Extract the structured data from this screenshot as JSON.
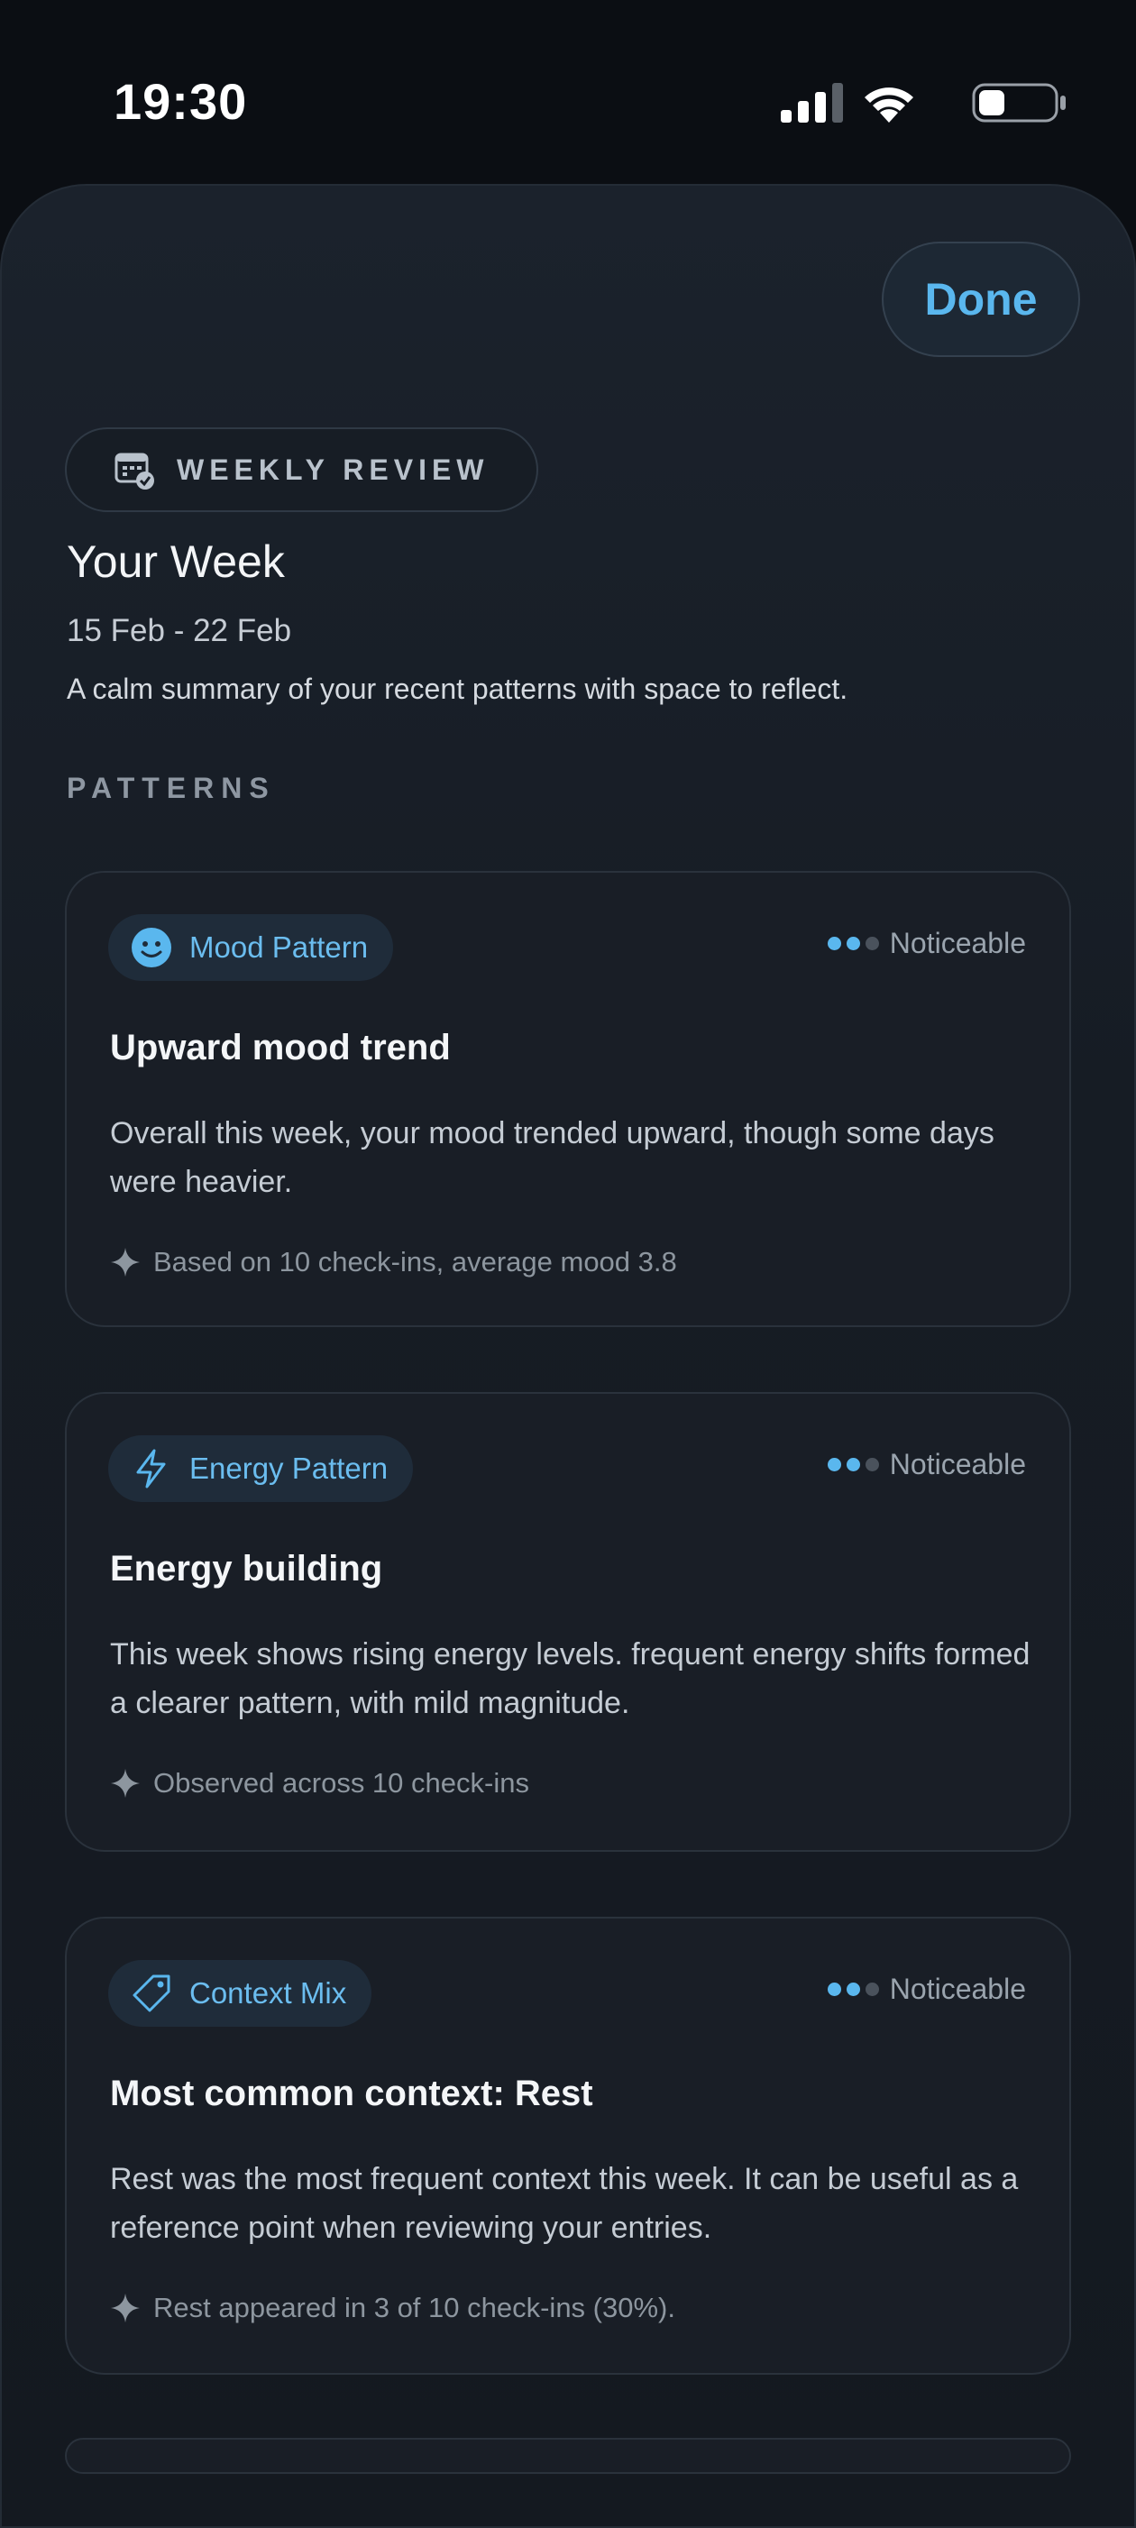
{
  "status_bar": {
    "time": "19:30",
    "battery_level": 0.35
  },
  "header": {
    "done_label": "Done",
    "chip_label": "WEEKLY REVIEW"
  },
  "summary": {
    "title": "Your Week",
    "date_range": "15 Feb - 22 Feb",
    "subtitle": "A calm summary of your recent patterns with space to reflect."
  },
  "section": {
    "label": "PATTERNS"
  },
  "patterns": [
    {
      "tag": "Mood Pattern",
      "icon": "smiley-icon",
      "level": "Noticeable",
      "dots_on": 2,
      "title": "Upward mood trend",
      "body": "Overall this week, your mood trended upward, though some days were heavier.",
      "foot": "Based on 10 check-ins, average mood 3.8"
    },
    {
      "tag": "Energy Pattern",
      "icon": "lightning-icon",
      "level": "Noticeable",
      "dots_on": 2,
      "title": "Energy building",
      "body": "This week shows rising energy levels. frequent energy shifts formed a clearer pattern, with mild magnitude.",
      "foot": "Observed across 10 check-ins"
    },
    {
      "tag": "Context Mix",
      "icon": "tag-icon",
      "level": "Noticeable",
      "dots_on": 2,
      "title": "Most common context: Rest",
      "body": "Rest was the most frequent context this week. It can be useful as a reference point when reviewing your entries.",
      "foot": "Rest appeared in 3 of 10 check-ins (30%)."
    }
  ],
  "colors": {
    "accent": "#5ab7ee",
    "background": "#0b0e13",
    "card": "#191e26"
  }
}
